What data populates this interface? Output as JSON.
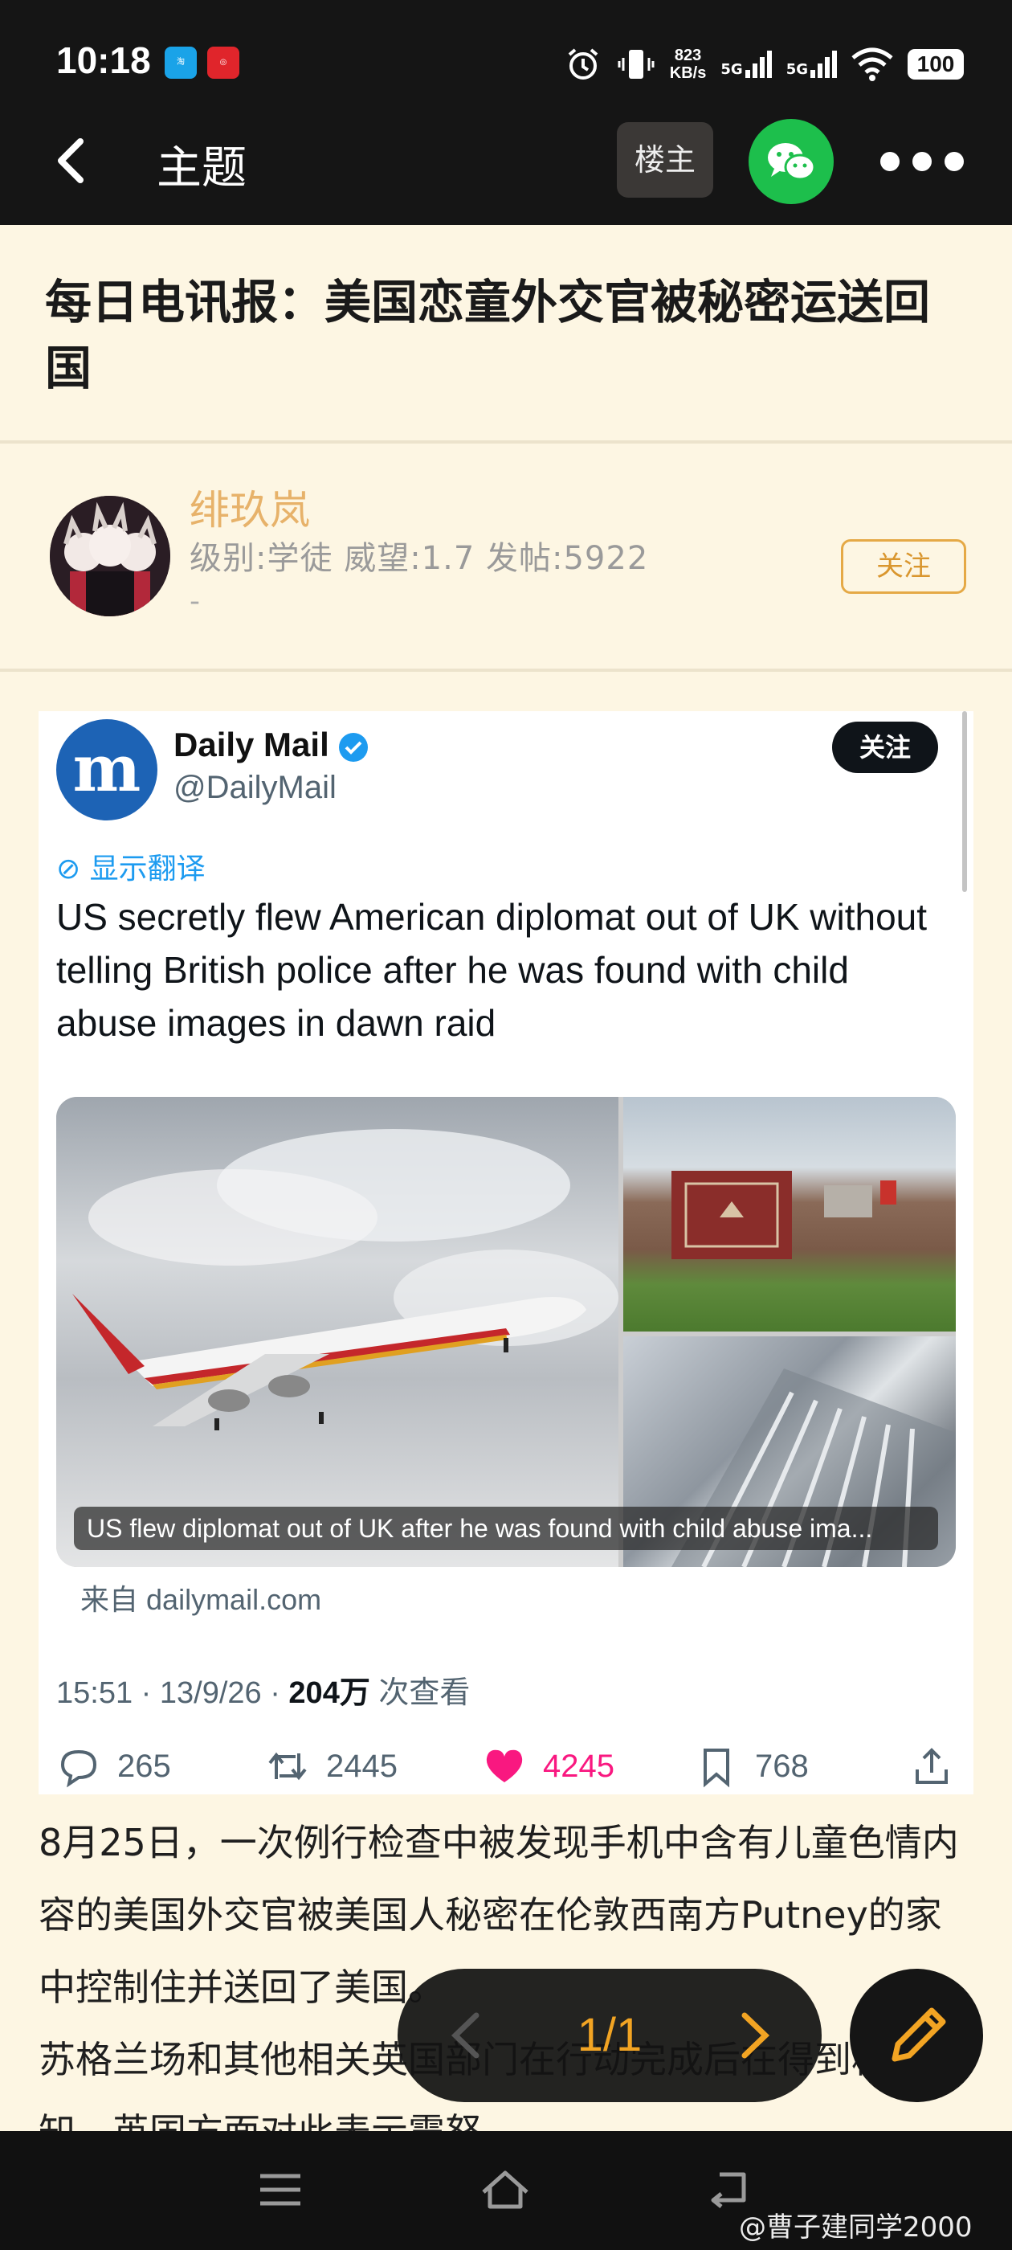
{
  "status_bar": {
    "time": "10:18",
    "net_speed_value": "823",
    "net_speed_unit": "KB/s",
    "sim1": "5G",
    "sim2": "5G",
    "battery": "100"
  },
  "app_bar": {
    "title": "主题",
    "owner_label": "楼主"
  },
  "thread": {
    "title": "每日电讯报：美国恋童外交官被秘密运送回国"
  },
  "author": {
    "name": "绯玖岚",
    "meta": "级别:学徒 威望:1.7 发帖:5922",
    "signature": "-",
    "follow_label": "关注"
  },
  "tweet": {
    "account_name": "Daily Mail",
    "handle": "@DailyMail",
    "follow_label": "关注",
    "translate_label": "显示翻译",
    "text": "US secretly flew American diplomat out of UK without telling British police after he was found with child abuse images in dawn raid",
    "image_caption": "US flew diplomat out of UK after he was found with child abuse ima...",
    "source_prefix": "来自",
    "source_domain": "dailymail.com",
    "timestamp": "15:51 · 13/9/26 · ",
    "views_count": "204万",
    "views_label": " 次查看",
    "replies": "265",
    "retweets": "2445",
    "likes": "4245",
    "bookmarks": "768"
  },
  "post_body": {
    "line1": "8月25日，一次例行检查中被发现手机中含有儿童色情内容的美国外交官被美国人秘密在伦敦西南方Putney的家中控制住并送回了美国。",
    "line2": "苏格兰场和其他相关英国部门在行动完成后在得到相关通知，英国方面对此表示震怒。"
  },
  "pager": {
    "label": "1/1"
  },
  "watermark": "@曹子建同学2000",
  "colors": {
    "accent": "#f2a423",
    "author_name": "#e7b26a",
    "wechat": "#1dbf4c",
    "like": "#f91880",
    "link": "#1d9bf0",
    "background": "#fdf6e3"
  }
}
